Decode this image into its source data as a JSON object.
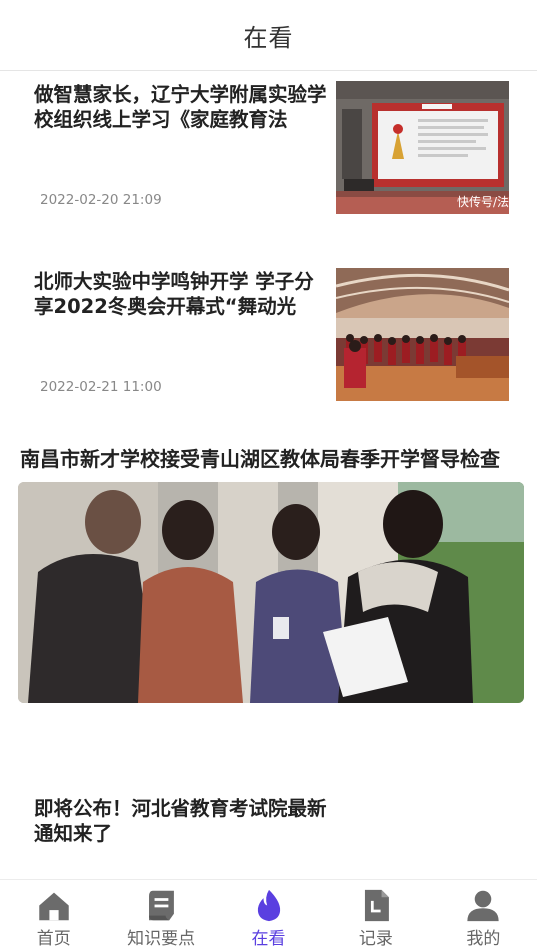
{
  "header": {
    "title": "在看"
  },
  "feed": {
    "articles": [
      {
        "title": "做智慧家长，辽宁大学附属实验学校组织线上学习《家庭教育法",
        "date": "2022-02-20 21:09",
        "thumb_watermark": "快传号/法"
      },
      {
        "title": "北师大实验中学鸣钟开学 学子分享2022冬奥会开幕式“舞动光",
        "date": "2022-02-21 11:00"
      }
    ],
    "featured": {
      "title": "南昌市新才学校接受青山湖区教体局春季开学督导检查"
    },
    "partial_article": {
      "title": "即将公布！河北省教育考试院最新通知来了"
    }
  },
  "tabbar": {
    "accent_color": "#5a3fe0",
    "tabs": [
      {
        "label": "首页",
        "icon": "home-icon"
      },
      {
        "label": "知识要点",
        "icon": "scroll-icon"
      },
      {
        "label": "在看",
        "icon": "flame-icon",
        "active": true
      },
      {
        "label": "记录",
        "icon": "document-icon"
      },
      {
        "label": "我的",
        "icon": "user-icon"
      }
    ]
  }
}
